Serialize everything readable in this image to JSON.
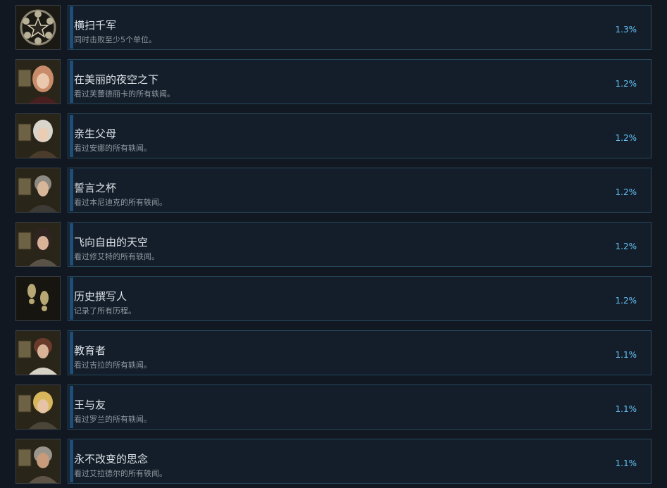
{
  "achievements": [
    {
      "title": "横扫千军",
      "description": "同时击败至少5个单位。",
      "percent": "1.3%",
      "icon": "sword-burst-emblem-icon"
    },
    {
      "title": "在美丽的夜空之下",
      "description": "看过芙蕾德丽卡的所有轶闻。",
      "percent": "1.2%",
      "icon": "portrait-icon"
    },
    {
      "title": "亲生父母",
      "description": "看过安娜的所有轶闻。",
      "percent": "1.2%",
      "icon": "portrait-icon"
    },
    {
      "title": "誓言之杯",
      "description": "看过本尼迪克的所有轶闻。",
      "percent": "1.2%",
      "icon": "portrait-icon"
    },
    {
      "title": "飞向自由的天空",
      "description": "看过修艾特的所有轶闻。",
      "percent": "1.2%",
      "icon": "portrait-icon"
    },
    {
      "title": "历史撰写人",
      "description": "记录了所有历程。",
      "percent": "1.2%",
      "icon": "footprints-icon"
    },
    {
      "title": "教育者",
      "description": "看过吉拉的所有轶闻。",
      "percent": "1.1%",
      "icon": "portrait-icon"
    },
    {
      "title": "王与友",
      "description": "看过罗兰的所有轶闻。",
      "percent": "1.1%",
      "icon": "portrait-icon"
    },
    {
      "title": "永不改变的思念",
      "description": "看过艾拉德尔的所有轶闻。",
      "percent": "1.1%",
      "icon": "portrait-icon"
    }
  ],
  "colors": {
    "background": "#111822",
    "card_background": "#131e2a",
    "card_border": "#27485c",
    "accent_bar": "#1f4f78",
    "title_text": "#dfe3e8",
    "description_text": "#8f98a0",
    "percent_text": "#66c0f4"
  }
}
